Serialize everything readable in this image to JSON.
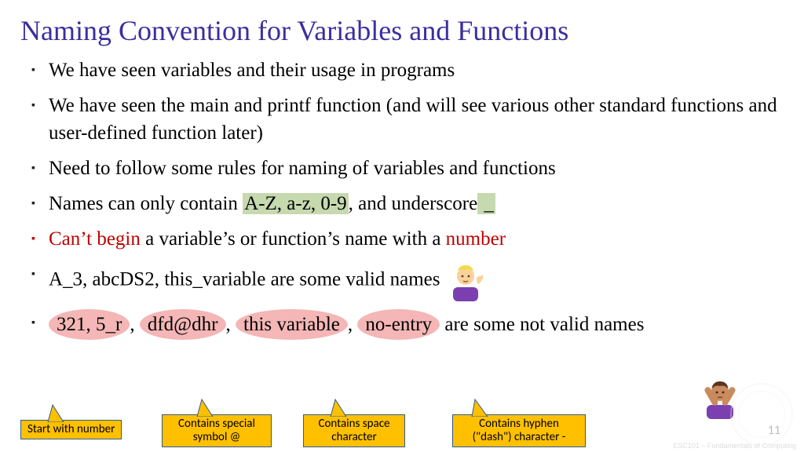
{
  "title": "Naming Convention for Variables and Functions",
  "bullets": {
    "b1": "We have seen variables and their usage in programs",
    "b2": "We have seen the main and printf function (and will see various other standard functions and user-defined function later)",
    "b3": "Need to follow some rules for naming of variables and functions",
    "b4_pre": "Names can only contain ",
    "b4_hl1": "A-Z, a-z, 0-9",
    "b4_mid": ", and underscore",
    "b4_hl2": " _ ",
    "b5_red1": "Can’t begin",
    "b5_mid": " a variable’s or function’s name with a ",
    "b5_red2": "number",
    "b6": "A_3, abcDS2, this_variable are some valid names ",
    "b7_o1": "321, 5_r",
    "b7_s1": ", ",
    "b7_o2": "dfd@dhr",
    "b7_s2": ", ",
    "b7_o3": "this variable",
    "b7_s3": ", ",
    "b7_o4": "no-entry",
    "b7_tail": " are some not valid names"
  },
  "callouts": {
    "c1": "Start with number",
    "c2": "Contains special symbol @",
    "c3": "Contains space character",
    "c4": "Contains hyphen (\"dash\") character -"
  },
  "pagenum": "11",
  "watermark": "ESC101 – Fundamentals of Computing"
}
